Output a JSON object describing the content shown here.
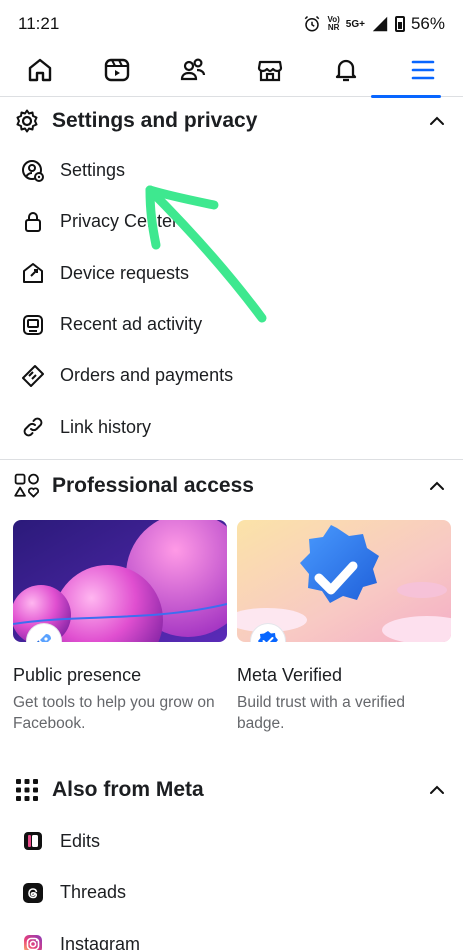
{
  "status": {
    "time": "11:21",
    "net_top": "Vo)",
    "net_bottom": "NR",
    "net_5g": "5G+",
    "battery": "56%"
  },
  "nav": {
    "tabs": [
      {
        "icon": "home-icon"
      },
      {
        "icon": "video-icon"
      },
      {
        "icon": "friends-icon"
      },
      {
        "icon": "marketplace-icon"
      },
      {
        "icon": "bell-icon"
      },
      {
        "icon": "menu-icon"
      }
    ],
    "active_color": "#0866ff"
  },
  "settings_section": {
    "title": "Settings and privacy",
    "items": [
      {
        "label": "Settings",
        "icon": "settings-user-icon"
      },
      {
        "label": "Privacy Center",
        "icon": "lock-icon"
      },
      {
        "label": "Device requests",
        "icon": "device-home-icon"
      },
      {
        "label": "Recent ad activity",
        "icon": "ad-activity-icon"
      },
      {
        "label": "Orders and payments",
        "icon": "tag-icon"
      },
      {
        "label": "Link history",
        "icon": "link-icon"
      }
    ]
  },
  "professional_section": {
    "title": "Professional access",
    "cards": [
      {
        "title": "Public presence",
        "desc": "Get tools to help you grow on Facebook.",
        "icon": "rocket-icon"
      },
      {
        "title": "Meta Verified",
        "desc": "Build trust with a verified badge.",
        "icon": "verified-badge-icon"
      }
    ]
  },
  "meta_section": {
    "title": "Also from Meta",
    "items": [
      {
        "label": "Edits",
        "icon": "edits-icon"
      },
      {
        "label": "Threads",
        "icon": "threads-icon"
      },
      {
        "label": "Instagram",
        "icon": "instagram-icon"
      }
    ]
  },
  "annotation": {
    "arrow_color": "#3ee88f"
  }
}
